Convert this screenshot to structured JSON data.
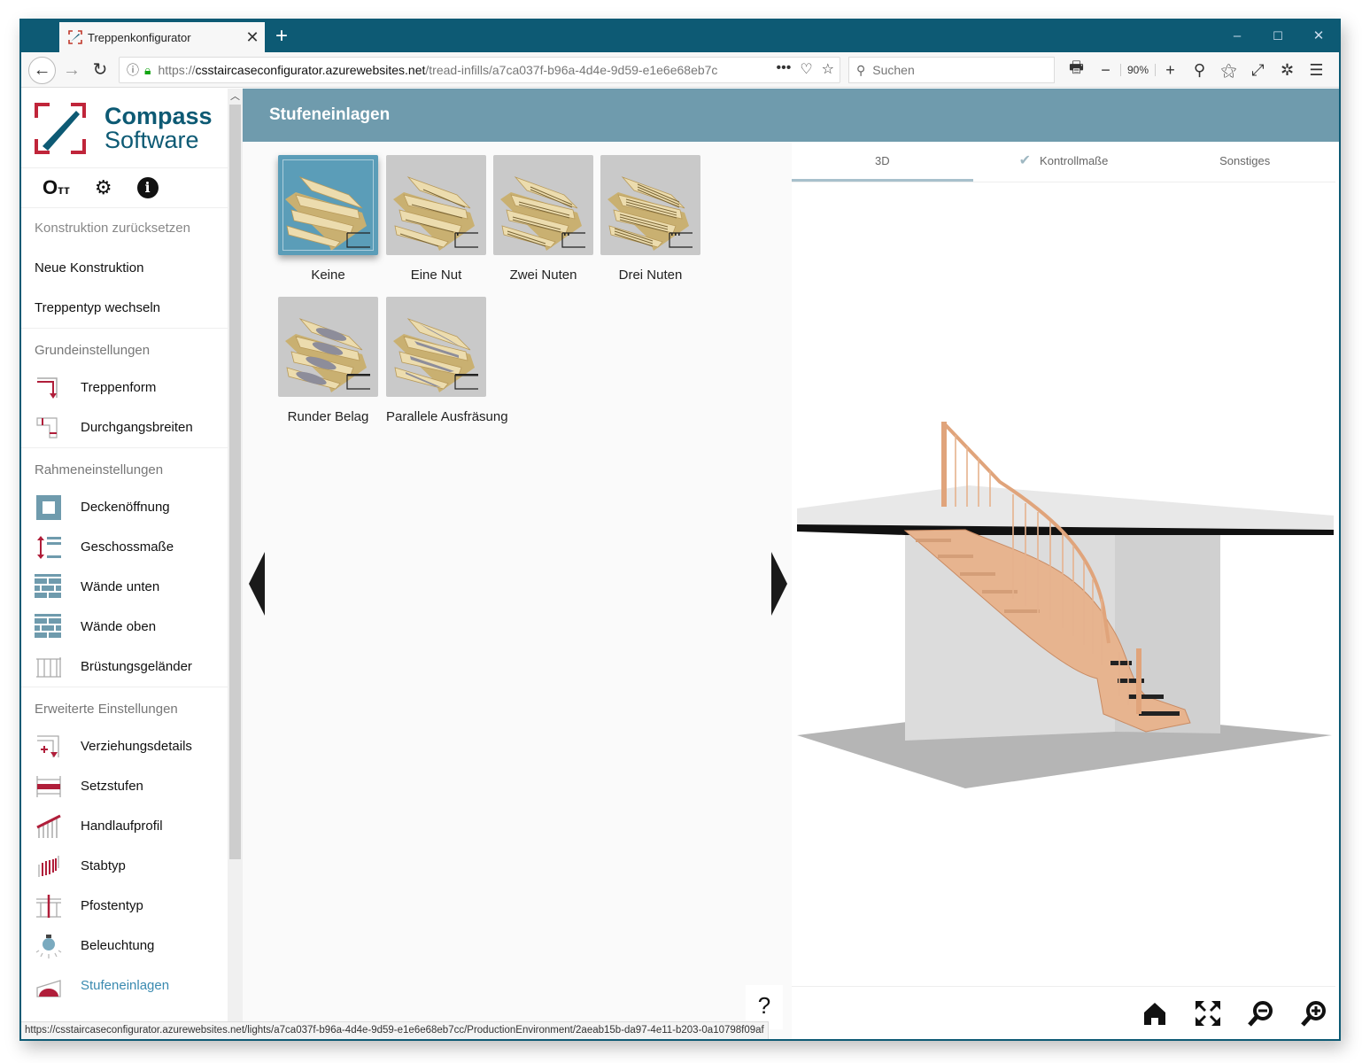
{
  "browser": {
    "tab_title": "Treppenkonfigurator",
    "new_tab_symbol": "+",
    "window_controls": {
      "minimize": "–",
      "maximize": "☐",
      "close": "✕"
    },
    "url_prefix": "https://",
    "url_domain": "csstaircaseconfigurator.azurewebsites.net",
    "url_path": "/tread-infills/a7ca037f-b96a-4d4e-9d59-e1e6e68eb7c",
    "search_placeholder": "Suchen",
    "zoom_level": "90%",
    "status_url": "https://csstaircaseconfigurator.azurewebsites.net/lights/a7ca037f-b96a-4d4e-9d59-e1e6e68eb7cc/ProductionEnvironment/2aeab15b-da97-4e11-b203-0a10798f09af"
  },
  "sidebar": {
    "logo_line1": "Compass",
    "logo_line2": "Software",
    "tool_icons": [
      "key-icon",
      "gear-icon",
      "info-icon"
    ],
    "links": [
      {
        "label": "Konstruktion zurücksetzen",
        "disabled": true
      },
      {
        "label": "Neue Konstruktion"
      },
      {
        "label": "Treppentyp wechseln"
      }
    ],
    "sections": [
      {
        "title": "Grundeinstellungen",
        "items": [
          {
            "label": "Treppenform",
            "icon": "stair-shape-icon"
          },
          {
            "label": "Durchgangsbreiten",
            "icon": "passage-width-icon"
          }
        ]
      },
      {
        "title": "Rahmeneinstellungen",
        "items": [
          {
            "label": "Deckenöffnung",
            "icon": "ceiling-opening-icon"
          },
          {
            "label": "Geschossmaße",
            "icon": "floor-height-icon"
          },
          {
            "label": "Wände unten",
            "icon": "wall-lower-icon"
          },
          {
            "label": "Wände oben",
            "icon": "wall-upper-icon"
          },
          {
            "label": "Brüstungsgeländer",
            "icon": "balustrade-icon"
          }
        ]
      },
      {
        "title": "Erweiterte Einstellungen",
        "items": [
          {
            "label": "Verziehungsdetails",
            "icon": "winder-details-icon"
          },
          {
            "label": "Setzstufen",
            "icon": "riser-icon"
          },
          {
            "label": "Handlaufprofil",
            "icon": "handrail-icon"
          },
          {
            "label": "Stabtyp",
            "icon": "baluster-icon"
          },
          {
            "label": "Pfostentyp",
            "icon": "newel-post-icon"
          },
          {
            "label": "Beleuchtung",
            "icon": "lighting-icon"
          },
          {
            "label": "Stufeneinlagen",
            "icon": "tread-infill-icon",
            "active": true
          }
        ]
      }
    ]
  },
  "main": {
    "title": "Stufeneinlagen",
    "options": [
      {
        "label": "Keine",
        "selected": true,
        "grooves": 0,
        "inlay": "none"
      },
      {
        "label": "Eine Nut",
        "grooves": 1,
        "inlay": "none"
      },
      {
        "label": "Zwei Nuten",
        "grooves": 2,
        "inlay": "none"
      },
      {
        "label": "Drei Nuten",
        "grooves": 3,
        "inlay": "none"
      },
      {
        "label": "Runder Belag",
        "grooves": 0,
        "inlay": "round"
      },
      {
        "label": "Parallele Ausfräsung",
        "grooves": 0,
        "inlay": "parallel"
      }
    ],
    "help_label": "?"
  },
  "viewer": {
    "tabs": [
      {
        "label": "3D",
        "active": true
      },
      {
        "label": "Kontrollmaße",
        "checked": true
      },
      {
        "label": "Sonstiges"
      }
    ],
    "tools": [
      "home-icon",
      "fit-view-icon",
      "zoom-out-icon",
      "zoom-in-icon"
    ]
  },
  "colors": {
    "browser_chrome": "#0d5a74",
    "header": "#6f9bad",
    "selected_option": "#5b9db8",
    "brand_red": "#b01e3a",
    "active_link": "#3a8ab0"
  }
}
